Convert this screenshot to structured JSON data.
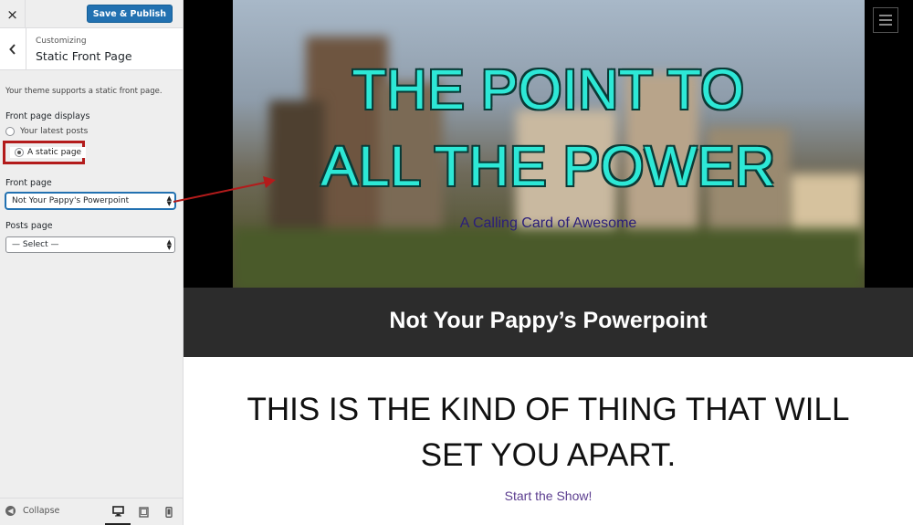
{
  "sidebar": {
    "close_icon": "×",
    "publish_label": "Save & Publish",
    "customizing_label": "Customizing",
    "section_title": "Static Front Page",
    "description": "Your theme supports a static front page.",
    "front_page_displays": {
      "label": "Front page displays",
      "options": [
        "Your latest posts",
        "A static page"
      ],
      "selected": "A static page"
    },
    "front_page": {
      "label": "Front page",
      "value": "Not Your Pappy's Powerpoint"
    },
    "posts_page": {
      "label": "Posts page",
      "value": "— Select —"
    },
    "collapse_label": "Collapse",
    "devices": [
      "desktop-icon",
      "tablet-icon",
      "mobile-icon"
    ]
  },
  "preview": {
    "hero_title_line1": "THE POINT TO",
    "hero_title_line2": "ALL THE POWER",
    "hero_subtitle": "A Calling Card of Awesome",
    "band_title": "Not Your Pappy’s Powerpoint",
    "content_heading": "THIS IS THE KIND OF THING THAT WILL SET YOU APART.",
    "cta_link": "Start the Show!"
  },
  "colors": {
    "accent_blue": "#2271b1",
    "highlight_red": "#b31b1b",
    "hero_title": "#2de8d6",
    "band_bg": "#2c2c2c",
    "cta": "#5b3d8f"
  }
}
